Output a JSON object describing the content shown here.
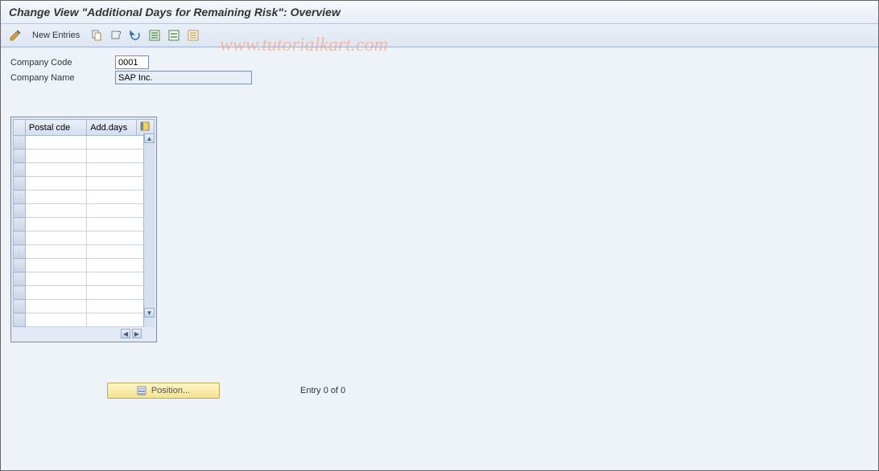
{
  "title": "Change View \"Additional Days for Remaining Risk\": Overview",
  "toolbar": {
    "new_entries_label": "New Entries"
  },
  "fields": {
    "company_code_label": "Company Code",
    "company_code_value": "0001",
    "company_name_label": "Company Name",
    "company_name_value": "SAP Inc."
  },
  "table": {
    "columns": {
      "postal": "Postal cde",
      "add_days": "Add.days"
    },
    "rows": [
      "",
      "",
      "",
      "",
      "",
      "",
      "",
      "",
      "",
      "",
      "",
      "",
      "",
      ""
    ]
  },
  "footer": {
    "position_label": "Position...",
    "entry_text": "Entry 0 of 0"
  },
  "watermark": "www.tutorialkart.com"
}
